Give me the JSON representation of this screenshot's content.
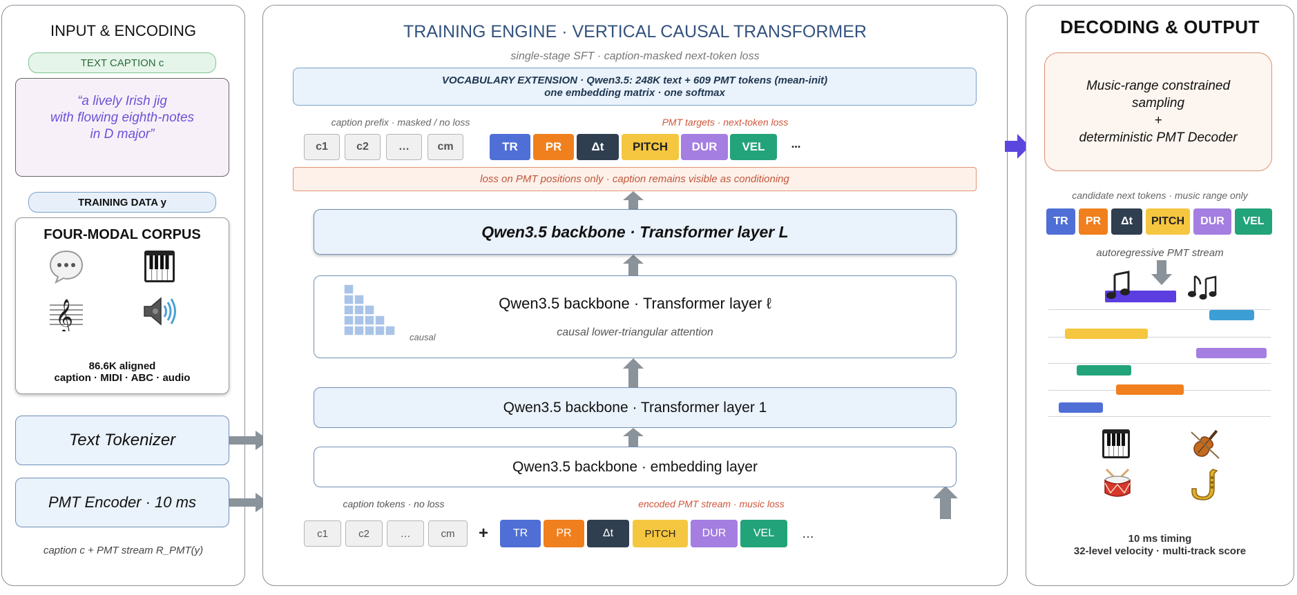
{
  "left": {
    "title": "INPUT & ENCODING",
    "text_caption_label": "TEXT CAPTION c",
    "caption_lines": [
      "“a lively Irish jig",
      "with flowing eighth-notes",
      "in D major”"
    ],
    "training_data_label": "TRAINING DATA y",
    "corpus_title": "FOUR-MODAL CORPUS",
    "corpus_stat": "86.6K aligned",
    "corpus_modalities": "caption · MIDI · ABC · audio",
    "text_tokenizer": "Text Tokenizer",
    "pmt_encoder": "PMT Encoder  ·  10 ms",
    "footer": "caption c  +  PMT stream R_PMT(y)"
  },
  "middle": {
    "title": "TRAINING ENGINE  ·  VERTICAL CAUSAL TRANSFORMER",
    "subtitle": "single-stage SFT  ·  caption-masked next-token loss",
    "vocab_line1": "VOCABULARY EXTENSION  ·  Qwen3.5: 248K text + 609 PMT tokens (mean-init)",
    "vocab_line2": "one embedding matrix  ·  one softmax",
    "caption_prefix_label": "caption prefix  ·  masked / no loss",
    "pmt_targets_label": "PMT targets  ·  next-token loss",
    "caption_tokens": [
      "c1",
      "c2",
      "…",
      "cm"
    ],
    "pmt_tokens": [
      "TR",
      "PR",
      "Δt",
      "PITCH",
      "DUR",
      "VEL"
    ],
    "ellipsis_dots": "•••",
    "loss_note": "loss on PMT positions only  ·  caption remains visible as conditioning",
    "layer_L": "Qwen3.5 backbone  ·  Transformer layer L",
    "layer_l": "Qwen3.5 backbone  ·  Transformer layer ℓ",
    "attention_note": "causal lower-triangular attention",
    "causal_label": "causal",
    "layer_1": "Qwen3.5 backbone  ·  Transformer layer 1",
    "embedding_layer": "Qwen3.5 backbone  ·  embedding layer",
    "caption_tokens_label": "caption tokens  ·  no loss",
    "encoded_stream_label": "encoded PMT stream  ·  music loss",
    "plus": "+",
    "ellipsis_end": "…"
  },
  "right": {
    "title": "DECODING & OUTPUT",
    "sampling_line1": "Music-range constrained",
    "sampling_line2": "sampling",
    "sampling_plus": "+",
    "sampling_line3": "deterministic PMT Decoder",
    "candidate_label": "candidate next tokens  ·  music range only",
    "tokens": [
      "TR",
      "PR",
      "Δt",
      "PITCH",
      "DUR",
      "VEL"
    ],
    "stream_label": "autoregressive PMT stream",
    "footer_line1": "10 ms timing",
    "footer_line2": "32-level velocity · multi-track score"
  },
  "colors": {
    "TR": "#4f6fd6",
    "PR": "#f07f1e",
    "DT": "#2f3f50",
    "PITCH": "#f5c63f",
    "DUR": "#a47ee0",
    "VEL": "#23a37a",
    "title_blue": "#33527e",
    "orange_text": "#d0553a",
    "arrow_gray": "#8a929a",
    "purple_arrow": "#5b46e0"
  },
  "icons": [
    "speech-bubble-icon",
    "piano-keys-icon",
    "treble-clef-icon",
    "speaker-icon",
    "music-note-icon",
    "violin-icon",
    "drum-icon",
    "saxophone-icon"
  ]
}
